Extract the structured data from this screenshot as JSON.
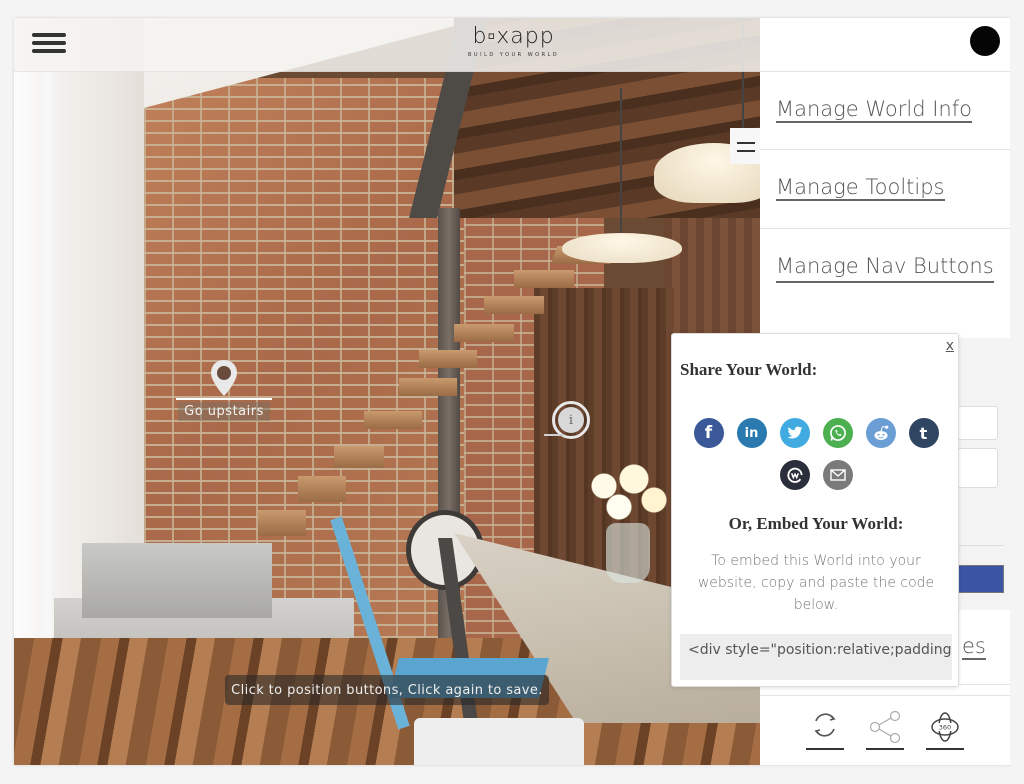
{
  "header": {
    "logo_main": "b▫xapp",
    "logo_tagline": "BUILD YOUR WORLD",
    "menu_icon": "hamburger-icon",
    "avatar_icon": "user-avatar"
  },
  "scene": {
    "nav_hotspot": {
      "label": "Go upstairs",
      "icon": "map-pin-icon"
    },
    "info_hotspot": {
      "glyph": "i",
      "icon": "info-icon"
    },
    "toast": "Click to position buttons, Click again to save."
  },
  "panel": {
    "handle_icon": "panel-toggle-icon",
    "menu": [
      {
        "label": "Manage World Info"
      },
      {
        "label": "Manage Tooltips"
      },
      {
        "label": "Manage Nav Buttons"
      },
      {
        "label_visible_fragment": "es"
      }
    ],
    "button_color": "#3b54a3",
    "bottom_icons": [
      {
        "name": "refresh-icon"
      },
      {
        "name": "share-icon"
      },
      {
        "name": "view-360-icon",
        "glyph": "360"
      }
    ]
  },
  "share_popup": {
    "close_label": "x",
    "title": "Share Your World:",
    "social": [
      {
        "name": "facebook",
        "glyph": "f",
        "color": "#3b5998"
      },
      {
        "name": "linkedin",
        "glyph": "in",
        "color": "#2a7ab0"
      },
      {
        "name": "twitter",
        "glyph": "✦",
        "color": "#41abe1"
      },
      {
        "name": "whatsapp",
        "glyph": "✆",
        "color": "#4caf50"
      },
      {
        "name": "reddit",
        "glyph": "☺",
        "color": "#6c9ed6"
      },
      {
        "name": "tumblr",
        "glyph": "t",
        "color": "#2f4562"
      },
      {
        "name": "workplace",
        "glyph": "@",
        "color": "#2b2f3b"
      },
      {
        "name": "email",
        "glyph": "✉",
        "color": "#7a7a7a"
      }
    ],
    "embed_title": "Or, Embed Your World:",
    "embed_description": "To embed this World into your website, copy and paste the code below.",
    "embed_code": "<div style=\"position:relative;padding-top"
  }
}
